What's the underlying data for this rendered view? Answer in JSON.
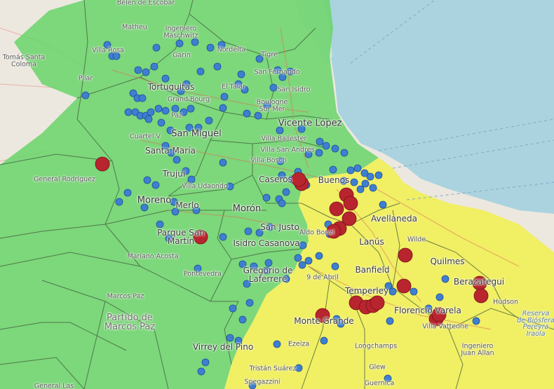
{
  "colors": {
    "water": "#aad3df",
    "land": "#ece8df",
    "zone_green": "#6ad36a",
    "zone_yellow": "#f2ef55",
    "zone_border": "#3d5a3a",
    "point_blue": "#3f7fd0",
    "point_red": "#b8252e"
  },
  "places": [
    {
      "id": "belen",
      "text": "Belén de Escobar"
    },
    {
      "id": "matheu",
      "text": "Matheu"
    },
    {
      "id": "ing_maschwitz",
      "text": "Ingeniero\nMaschwitz"
    },
    {
      "id": "tomas_santa_coloma",
      "text": "Tomás Santa\nColoma"
    },
    {
      "id": "villa_rosa",
      "text": "Villa Rosa"
    },
    {
      "id": "garin",
      "text": "Garín"
    },
    {
      "id": "nordelta",
      "text": "Nordelta"
    },
    {
      "id": "tigre",
      "text": "Tigre"
    },
    {
      "id": "pilar",
      "text": "Pilar"
    },
    {
      "id": "san_fernando",
      "text": "San Fernando"
    },
    {
      "id": "tortuguitas",
      "text": "Tortuguitas"
    },
    {
      "id": "el_talar",
      "text": "El Talar"
    },
    {
      "id": "san_isidro",
      "text": "San Isidro"
    },
    {
      "id": "grand_bourg",
      "text": "Grand Bourg"
    },
    {
      "id": "boulogne",
      "text": "Boulogne\nSur Mer"
    },
    {
      "id": "paz",
      "text": "Paz"
    },
    {
      "id": "vicente_lopez",
      "text": "Vicente López"
    },
    {
      "id": "cuartel_v",
      "text": "Cuartel V"
    },
    {
      "id": "san_miguel",
      "text": "San Miguel"
    },
    {
      "id": "villa_ballester",
      "text": "Villa Ballester"
    },
    {
      "id": "santa_maria",
      "text": "Santa María"
    },
    {
      "id": "villa_san_andres",
      "text": "Villa San Andrés"
    },
    {
      "id": "villa_bosch",
      "text": "Villa Bosch"
    },
    {
      "id": "general_rodriguez",
      "text": "General Rodríguez"
    },
    {
      "id": "trujui",
      "text": "Trujui"
    },
    {
      "id": "villa_udaondo",
      "text": "Villa Udaondo"
    },
    {
      "id": "caseros",
      "text": "Caseros"
    },
    {
      "id": "buenos_aires",
      "text": "Buenos"
    },
    {
      "id": "moreno",
      "text": "Moreno"
    },
    {
      "id": "merlo",
      "text": "Merlo"
    },
    {
      "id": "moron",
      "text": "Morón"
    },
    {
      "id": "avellaneda",
      "text": "Avellaneda"
    },
    {
      "id": "parque_san_martin",
      "text": "Parque San\nMartín"
    },
    {
      "id": "san_justo",
      "text": "San Justo"
    },
    {
      "id": "aldo_bonzi",
      "text": "Aldo Bonzi"
    },
    {
      "id": "lanus",
      "text": "Lanús"
    },
    {
      "id": "isidro_casanova",
      "text": "Isidro Casanova"
    },
    {
      "id": "wilde",
      "text": "Wilde"
    },
    {
      "id": "mariano_acosta",
      "text": "Mariano Acosta"
    },
    {
      "id": "quilmes",
      "text": "Quilmes"
    },
    {
      "id": "gregorio_laferrere",
      "text": "Gregorio de\nLaferrere"
    },
    {
      "id": "banfield",
      "text": "Banfield"
    },
    {
      "id": "pontevedra",
      "text": "Pontevedra"
    },
    {
      "id": "nueve_abril",
      "text": "9 de Abril"
    },
    {
      "id": "berazategui",
      "text": "Berazategui"
    },
    {
      "id": "marcos_paz",
      "text": "Marcos Paz"
    },
    {
      "id": "temperley",
      "text": "Temperley"
    },
    {
      "id": "hudson",
      "text": "Hudson"
    },
    {
      "id": "partido_marcos_paz",
      "text": "Partido de\nMarcos Paz"
    },
    {
      "id": "florencio_varela",
      "text": "Florencio Varela"
    },
    {
      "id": "reserva",
      "text": "Reserva\nde Biósfera\nPereyra\nIraola"
    },
    {
      "id": "monte_grande",
      "text": "Monte Grande"
    },
    {
      "id": "villa_vatteone",
      "text": "Villa Vatteone"
    },
    {
      "id": "ezeiza",
      "text": "Ezeiza"
    },
    {
      "id": "longchamps",
      "text": "Longchamps"
    },
    {
      "id": "ingeniero_juan_allan",
      "text": "Ingeniero\nJuan Allan"
    },
    {
      "id": "virrey_del_pino",
      "text": "Virrey del Pino"
    },
    {
      "id": "glew",
      "text": "Glew"
    },
    {
      "id": "tristan_suarez",
      "text": "Tristán Suárez"
    },
    {
      "id": "spegazzini",
      "text": "Spegazzini"
    },
    {
      "id": "guernica",
      "text": "Guernica"
    },
    {
      "id": "general_las",
      "text": "General Las"
    }
  ]
}
